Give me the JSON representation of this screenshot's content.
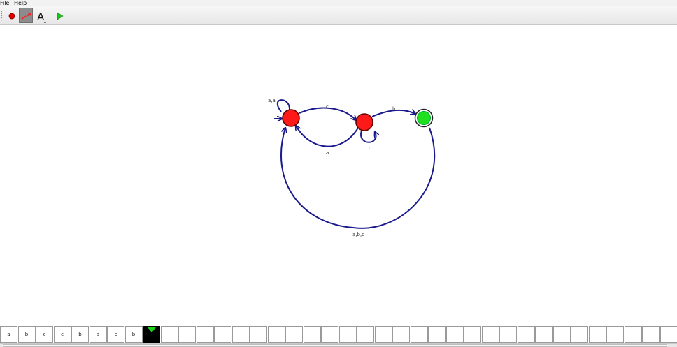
{
  "menu": {
    "file": "File",
    "help": "Help"
  },
  "toolbar": {
    "tools": [
      {
        "name": "state-tool",
        "icon": "red-state-dot-icon"
      },
      {
        "name": "transition-tool",
        "icon": "red-arrow-icon",
        "selected": true
      },
      {
        "name": "text-tool",
        "icon": "letter-a-icon",
        "glyph": "A"
      },
      {
        "name": "run-tool",
        "icon": "green-play-icon"
      }
    ]
  },
  "automaton": {
    "colors": {
      "state": "#ff1a1a",
      "accept": "#1ee01e",
      "edge": "#1a1a8c"
    },
    "states": [
      {
        "id": "q0",
        "accepting": false
      },
      {
        "id": "q1",
        "accepting": false
      },
      {
        "id": "q2",
        "accepting": true
      }
    ],
    "transitions": [
      {
        "from": "q0",
        "to": "q0",
        "label": "a,a"
      },
      {
        "from": "q0",
        "to": "q1",
        "label": "c"
      },
      {
        "from": "q1",
        "to": "q0",
        "label": "a"
      },
      {
        "from": "q1",
        "to": "q1",
        "label": "c"
      },
      {
        "from": "q1",
        "to": "q2",
        "label": "b"
      },
      {
        "from": "q2",
        "to": "q0",
        "label": "a,b,c"
      }
    ]
  },
  "tape": {
    "symbols": [
      "a",
      "b",
      "c",
      "c",
      "b",
      "a",
      "c",
      "b"
    ],
    "head_index": 8,
    "total_cells": 38
  }
}
